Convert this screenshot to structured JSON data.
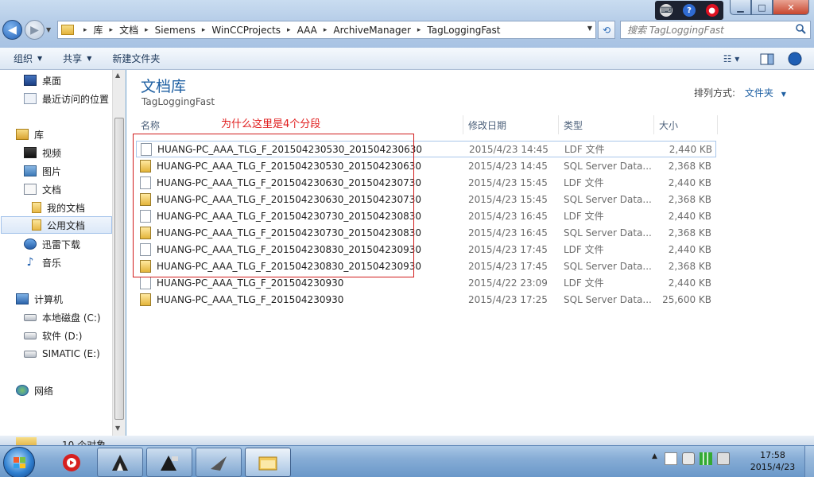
{
  "window": {
    "caption_buttons": {
      "minimize": "▁",
      "maximize": "□",
      "close": "✕"
    },
    "tray_mini_icons": [
      "keyboard-icon",
      "help-icon",
      "stop-icon"
    ],
    "tray_mini_help": "?"
  },
  "address_bar": {
    "breadcrumbs": [
      "库",
      "文档",
      "Siemens",
      "WinCCProjects",
      "AAA",
      "ArchiveManager",
      "TagLoggingFast"
    ],
    "separator": "▸"
  },
  "search": {
    "placeholder": "搜索 TagLoggingFast"
  },
  "command_bar": {
    "organize": "组织",
    "share": "共享",
    "new_folder": "新建文件夹",
    "view_glyph": "☷ ▾",
    "help": "?"
  },
  "nav_pane": {
    "items": [
      {
        "label": "桌面",
        "icon": "desktop-icon"
      },
      {
        "label": "最近访问的位置",
        "icon": "recent-places-icon"
      },
      {
        "label": "库",
        "icon": "library-icon"
      },
      {
        "label": "视频",
        "icon": "video-icon"
      },
      {
        "label": "图片",
        "icon": "pictures-icon"
      },
      {
        "label": "文档",
        "icon": "documents-icon"
      },
      {
        "label": "我的文档",
        "icon": "folder-icon"
      },
      {
        "label": "公用文档",
        "icon": "folder-icon"
      },
      {
        "label": "迅雷下载",
        "icon": "thunder-icon"
      },
      {
        "label": "音乐",
        "icon": "music-icon"
      },
      {
        "label": "计算机",
        "icon": "computer-icon"
      },
      {
        "label": "本地磁盘 (C:)",
        "icon": "drive-icon"
      },
      {
        "label": "软件 (D:)",
        "icon": "drive-icon"
      },
      {
        "label": "SIMATIC (E:)",
        "icon": "drive-icon"
      },
      {
        "label": "网络",
        "icon": "network-icon"
      }
    ]
  },
  "library": {
    "title": "文档库",
    "subtitle": "TagLoggingFast",
    "arrange_label": "排列方式:",
    "arrange_value": "文件夹"
  },
  "columns": [
    "名称",
    "修改日期",
    "类型",
    "大小"
  ],
  "annotation": "为什么这里是4个分段",
  "files": [
    {
      "name": "HUANG-PC_AAA_TLG_F_201504230530_201504230630",
      "date": "2015/4/23 14:45",
      "type": "LDF 文件",
      "size": "2,440 KB",
      "kind": "ldf"
    },
    {
      "name": "HUANG-PC_AAA_TLG_F_201504230530_201504230630",
      "date": "2015/4/23 14:45",
      "type": "SQL Server Data...",
      "size": "2,368 KB",
      "kind": "sql"
    },
    {
      "name": "HUANG-PC_AAA_TLG_F_201504230630_201504230730",
      "date": "2015/4/23 15:45",
      "type": "LDF 文件",
      "size": "2,440 KB",
      "kind": "ldf"
    },
    {
      "name": "HUANG-PC_AAA_TLG_F_201504230630_201504230730",
      "date": "2015/4/23 15:45",
      "type": "SQL Server Data...",
      "size": "2,368 KB",
      "kind": "sql"
    },
    {
      "name": "HUANG-PC_AAA_TLG_F_201504230730_201504230830",
      "date": "2015/4/23 16:45",
      "type": "LDF 文件",
      "size": "2,440 KB",
      "kind": "ldf"
    },
    {
      "name": "HUANG-PC_AAA_TLG_F_201504230730_201504230830",
      "date": "2015/4/23 16:45",
      "type": "SQL Server Data...",
      "size": "2,368 KB",
      "kind": "sql"
    },
    {
      "name": "HUANG-PC_AAA_TLG_F_201504230830_201504230930",
      "date": "2015/4/23 17:45",
      "type": "LDF 文件",
      "size": "2,440 KB",
      "kind": "ldf"
    },
    {
      "name": "HUANG-PC_AAA_TLG_F_201504230830_201504230930",
      "date": "2015/4/23 17:45",
      "type": "SQL Server Data...",
      "size": "2,368 KB",
      "kind": "sql"
    },
    {
      "name": "HUANG-PC_AAA_TLG_F_201504230930",
      "date": "2015/4/22 23:09",
      "type": "LDF 文件",
      "size": "2,440 KB",
      "kind": "ldf"
    },
    {
      "name": "HUANG-PC_AAA_TLG_F_201504230930",
      "date": "2015/4/23 17:25",
      "type": "SQL Server Data...",
      "size": "25,600 KB",
      "kind": "sql"
    }
  ],
  "status": {
    "text": "10 个对象"
  },
  "taskbar": {
    "buttons": [
      "media-player-icon",
      "wincc-runtime-icon",
      "wincc-explorer-icon",
      "navigator-icon",
      "windows-explorer-icon"
    ]
  },
  "clock": {
    "time": "17:58",
    "date": "2015/4/23"
  },
  "colors": {
    "accent": "#1e5fa2",
    "annotation": "#e01b1b",
    "selection": "#a3c2ea"
  }
}
